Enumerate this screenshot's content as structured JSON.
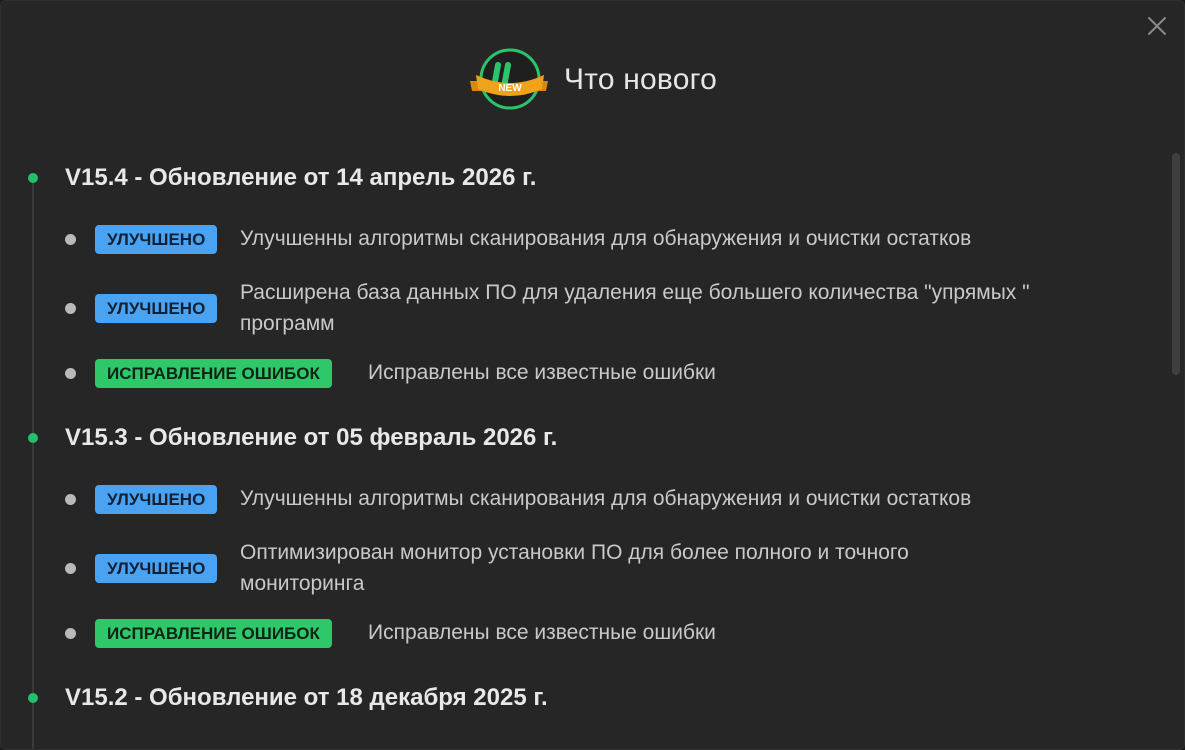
{
  "dialog": {
    "title": "Что нового",
    "logo_badge_text": "NEW",
    "logo_letter": "U"
  },
  "colors": {
    "accent_green": "#23c16b",
    "badge_improved": "#4aa3f2",
    "badge_fix": "#2ec86a",
    "background": "#262626"
  },
  "versions": [
    {
      "title": "V15.4 - Обновление от 14 апрель 2026 г.",
      "items": [
        {
          "badge": "УЛУЧШЕНО",
          "type": "improved",
          "text_lines": [
            "Улучшенны алгоритмы сканирования для обнаружения и очистки остатков"
          ]
        },
        {
          "badge": "УЛУЧШЕНО",
          "type": "improved",
          "text_lines": [
            "Расширена база данных ПО для удаления еще большего количества \"упрямых \"",
            "программ"
          ]
        },
        {
          "badge": "ИСПРАВЛЕНИЕ ОШИБОК",
          "type": "fix",
          "text_lines": [
            "Исправлены все известные ошибки"
          ]
        }
      ]
    },
    {
      "title": "V15.3 - Обновление от 05 февраль 2026 г.",
      "items": [
        {
          "badge": "УЛУЧШЕНО",
          "type": "improved",
          "text_lines": [
            "Улучшенны алгоритмы сканирования для обнаружения и очистки остатков"
          ]
        },
        {
          "badge": "УЛУЧШЕНО",
          "type": "improved",
          "text_lines": [
            "Оптимизирован монитор установки ПО для более полного и точного",
            "мониторинга"
          ]
        },
        {
          "badge": "ИСПРАВЛЕНИЕ ОШИБОК",
          "type": "fix",
          "text_lines": [
            "Исправлены все известные ошибки"
          ]
        }
      ]
    },
    {
      "title": "V15.2 - Обновление от 18 декабря 2025 г.",
      "items": []
    }
  ]
}
